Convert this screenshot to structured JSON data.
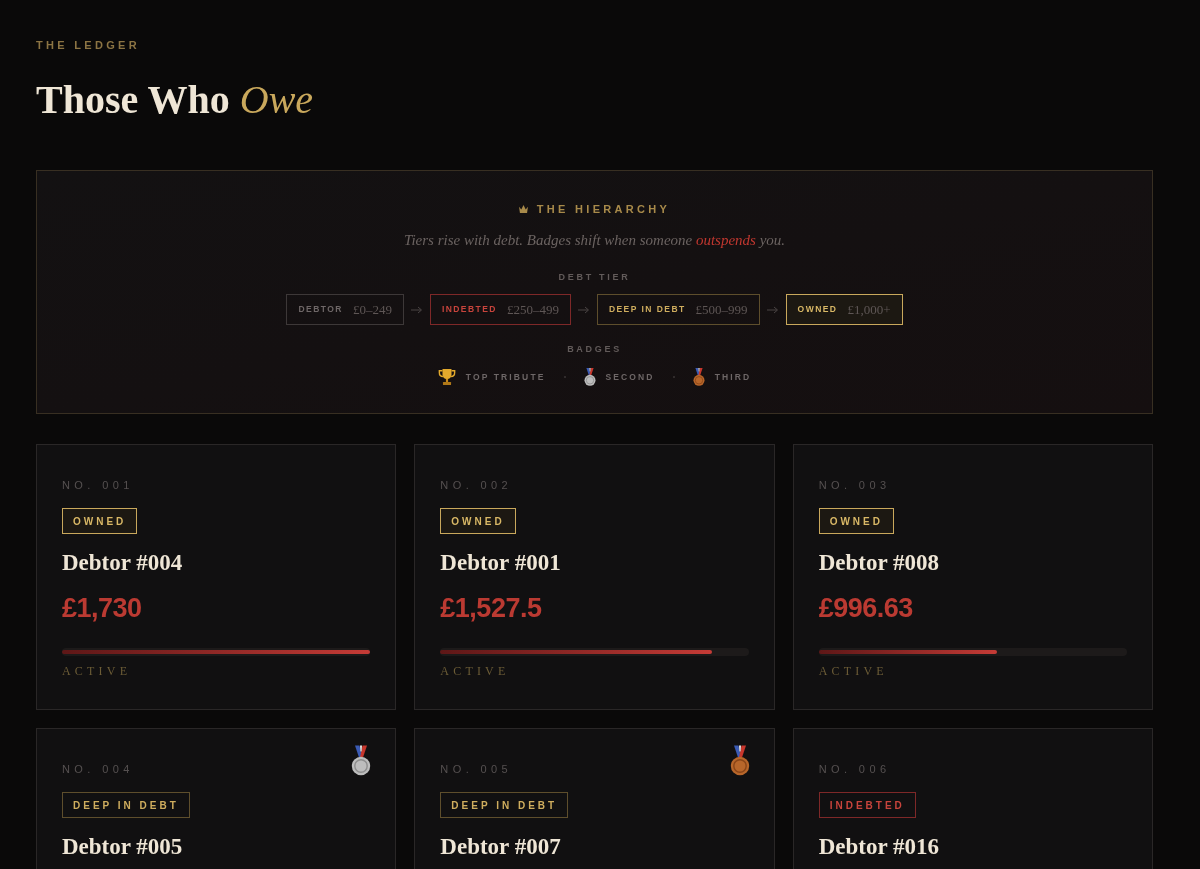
{
  "header": {
    "eyebrow": "THE LEDGER",
    "title": "Those Who",
    "title_accent": "Owe"
  },
  "hierarchy": {
    "title": "THE HIERARCHY",
    "subtitle": {
      "before": "Tiers rise with debt. Badges shift when someone",
      "highlight": "outspends",
      "after": "you."
    },
    "tier_label": "DEBT TIER",
    "tiers": [
      {
        "kind": "debtor",
        "label": "DEBTOR",
        "range": "£0–249"
      },
      {
        "kind": "indebted",
        "label": "INDEBTED",
        "range": "£250–499"
      },
      {
        "kind": "deep",
        "label": "DEEP IN DEBT",
        "range": "£500–999"
      },
      {
        "kind": "owned",
        "label": "OWNED",
        "range": "£1,000+"
      }
    ],
    "badges_label": "BADGES",
    "badges": [
      {
        "kind": "trophy",
        "label": "TOP TRIBUTE"
      },
      {
        "kind": "silver",
        "label": "SECOND"
      },
      {
        "kind": "bronze",
        "label": "THIRD"
      }
    ]
  },
  "cards": [
    {
      "number": "NO. 001",
      "tier": {
        "kind": "owned",
        "label": "OWNED"
      },
      "name": "Debtor #004",
      "amount": "£1,730",
      "level": 1,
      "status": "ACTIVE"
    },
    {
      "number": "NO. 002",
      "tier": {
        "kind": "owned",
        "label": "OWNED"
      },
      "name": "Debtor #001",
      "amount": "£1,527.5",
      "level": 0.88,
      "status": "ACTIVE"
    },
    {
      "number": "NO. 003",
      "tier": {
        "kind": "owned",
        "label": "OWNED"
      },
      "name": "Debtor #008",
      "amount": "£996.63",
      "level": 0.58,
      "status": "ACTIVE"
    },
    {
      "number": "NO. 004",
      "medal": {
        "kind": "silver"
      },
      "tier": {
        "kind": "deep",
        "label": "DEEP IN DEBT"
      },
      "name": "Debtor #005"
    },
    {
      "number": "NO. 005",
      "medal": {
        "kind": "bronze"
      },
      "tier": {
        "kind": "deep",
        "label": "DEEP IN DEBT"
      },
      "name": "Debtor #007"
    },
    {
      "number": "NO. 006",
      "tier": {
        "kind": "indebted",
        "label": "INDEBTED"
      },
      "name": "Debtor #016"
    }
  ]
}
